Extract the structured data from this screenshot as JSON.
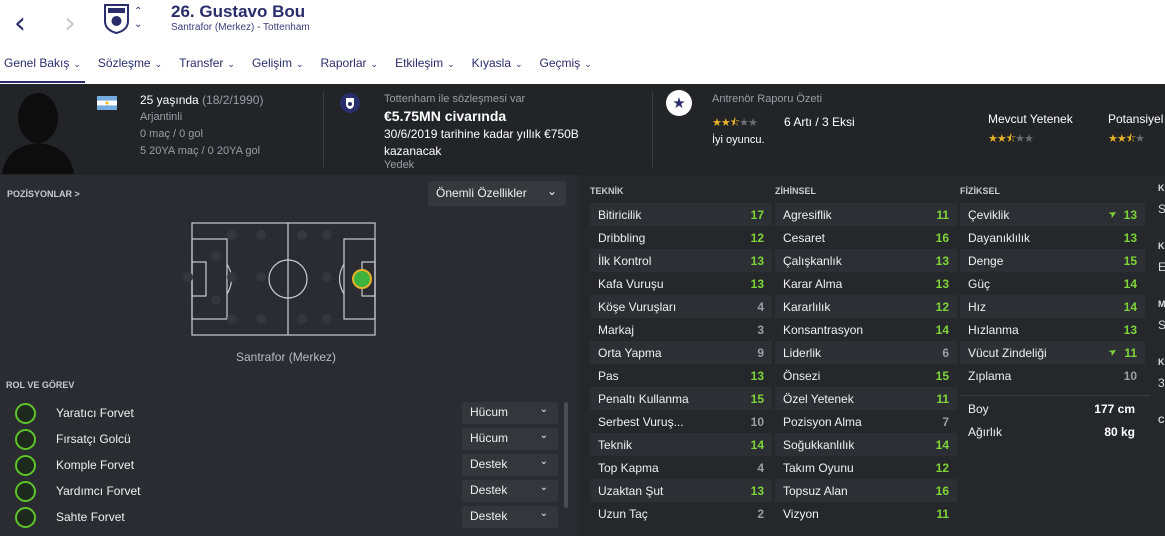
{
  "header": {
    "player_title": "26. Gustavo Bou",
    "subtitle": "Santrafor (Merkez) - Tottenham",
    "back_icon": "back-arrow-icon",
    "forward_icon": "forward-arrow-icon"
  },
  "tabs": [
    {
      "label": "Genel Bakış"
    },
    {
      "label": "Sözleşme"
    },
    {
      "label": "Transfer"
    },
    {
      "label": "Gelişim"
    },
    {
      "label": "Raporlar"
    },
    {
      "label": "Etkileşim"
    },
    {
      "label": "Kıyasla"
    },
    {
      "label": "Geçmiş"
    }
  ],
  "info": {
    "age": "25 yaşında",
    "dob": "(18/2/1990)",
    "nationality": "Arjantinli",
    "caps": "0 maç / 0 gol",
    "u20": "5 20YA maç / 0 20YA gol",
    "contract_header": "Tottenham ile sözleşmesi var",
    "value": "€5.75MN civarında",
    "wage": "30/6/2019 tarihine kadar yıllık €750B kazanacak",
    "squad_status": "Yedek",
    "report_title": "Antrenör Raporu Özeti",
    "report_pros_cons": "6 Artı / 3 Eksi",
    "report_verdict": "İyi oyuncu.",
    "current_ability_label": "Mevcut Yetenek",
    "potential_label": "Potansiyel",
    "report_stars": 2.5,
    "current_ability_stars": 2.5,
    "potential_stars": 2.5
  },
  "positions": {
    "heading": "POZİSYONLAR >",
    "dropdown": "Önemli Özellikler",
    "position_label": "Santrafor (Merkez)"
  },
  "roles": {
    "heading": "ROL VE GÖREV",
    "items": [
      {
        "name": "Yaratıcı Forvet",
        "duty": "Hücum"
      },
      {
        "name": "Fırsatçı Golcü",
        "duty": "Hücum"
      },
      {
        "name": "Komple Forvet",
        "duty": "Destek"
      },
      {
        "name": "Yardımcı Forvet",
        "duty": "Destek"
      },
      {
        "name": "Sahte Forvet",
        "duty": "Destek"
      }
    ]
  },
  "technical": {
    "heading": "TEKNİK",
    "items": [
      {
        "name": "Bitiricilik",
        "value": "17"
      },
      {
        "name": "Dribbling",
        "value": "12"
      },
      {
        "name": "İlk Kontrol",
        "value": "13"
      },
      {
        "name": "Kafa Vuruşu",
        "value": "13"
      },
      {
        "name": "Köşe Vuruşları",
        "value": "4"
      },
      {
        "name": "Markaj",
        "value": "3"
      },
      {
        "name": "Orta Yapma",
        "value": "9"
      },
      {
        "name": "Pas",
        "value": "13"
      },
      {
        "name": "Penaltı Kullanma",
        "value": "15"
      },
      {
        "name": "Serbest Vuruş...",
        "value": "10"
      },
      {
        "name": "Teknik",
        "value": "14"
      },
      {
        "name": "Top Kapma",
        "value": "4"
      },
      {
        "name": "Uzaktan Şut",
        "value": "13"
      },
      {
        "name": "Uzun Taç",
        "value": "2"
      }
    ]
  },
  "mental": {
    "heading": "ZİHİNSEL",
    "items": [
      {
        "name": "Agresiflik",
        "value": "11"
      },
      {
        "name": "Cesaret",
        "value": "16"
      },
      {
        "name": "Çalışkanlık",
        "value": "13"
      },
      {
        "name": "Karar Alma",
        "value": "13"
      },
      {
        "name": "Kararlılık",
        "value": "12"
      },
      {
        "name": "Konsantrasyon",
        "value": "14"
      },
      {
        "name": "Liderlik",
        "value": "6"
      },
      {
        "name": "Önsezi",
        "value": "15"
      },
      {
        "name": "Özel Yetenek",
        "value": "11"
      },
      {
        "name": "Pozisyon Alma",
        "value": "7"
      },
      {
        "name": "Soğukkanlılık",
        "value": "14"
      },
      {
        "name": "Takım Oyunu",
        "value": "12"
      },
      {
        "name": "Topsuz Alan",
        "value": "16"
      },
      {
        "name": "Vizyon",
        "value": "11"
      }
    ]
  },
  "physical": {
    "heading": "FİZİKSEL",
    "items": [
      {
        "name": "Çeviklik",
        "value": "13",
        "trend": true
      },
      {
        "name": "Dayanıklılık",
        "value": "13"
      },
      {
        "name": "Denge",
        "value": "15"
      },
      {
        "name": "Güç",
        "value": "14"
      },
      {
        "name": "Hız",
        "value": "14"
      },
      {
        "name": "Hızlanma",
        "value": "13"
      },
      {
        "name": "Vücut Zindeliği",
        "value": "11",
        "trend": true
      },
      {
        "name": "Zıplama",
        "value": "10"
      }
    ],
    "height_label": "Boy",
    "height": "177 cm",
    "weight_label": "Ağırlık",
    "weight": "80 kg"
  },
  "right_edge": {
    "letters": [
      "K",
      "S",
      "K",
      "E",
      "M",
      "S",
      "K",
      "3",
      "C"
    ]
  },
  "colors": {
    "header_bg": "#ffffff",
    "accent": "#2a2d6b",
    "attr_high": "#7fd43a",
    "attr_low": "#9b9ea5",
    "star": "#e8b12a"
  }
}
